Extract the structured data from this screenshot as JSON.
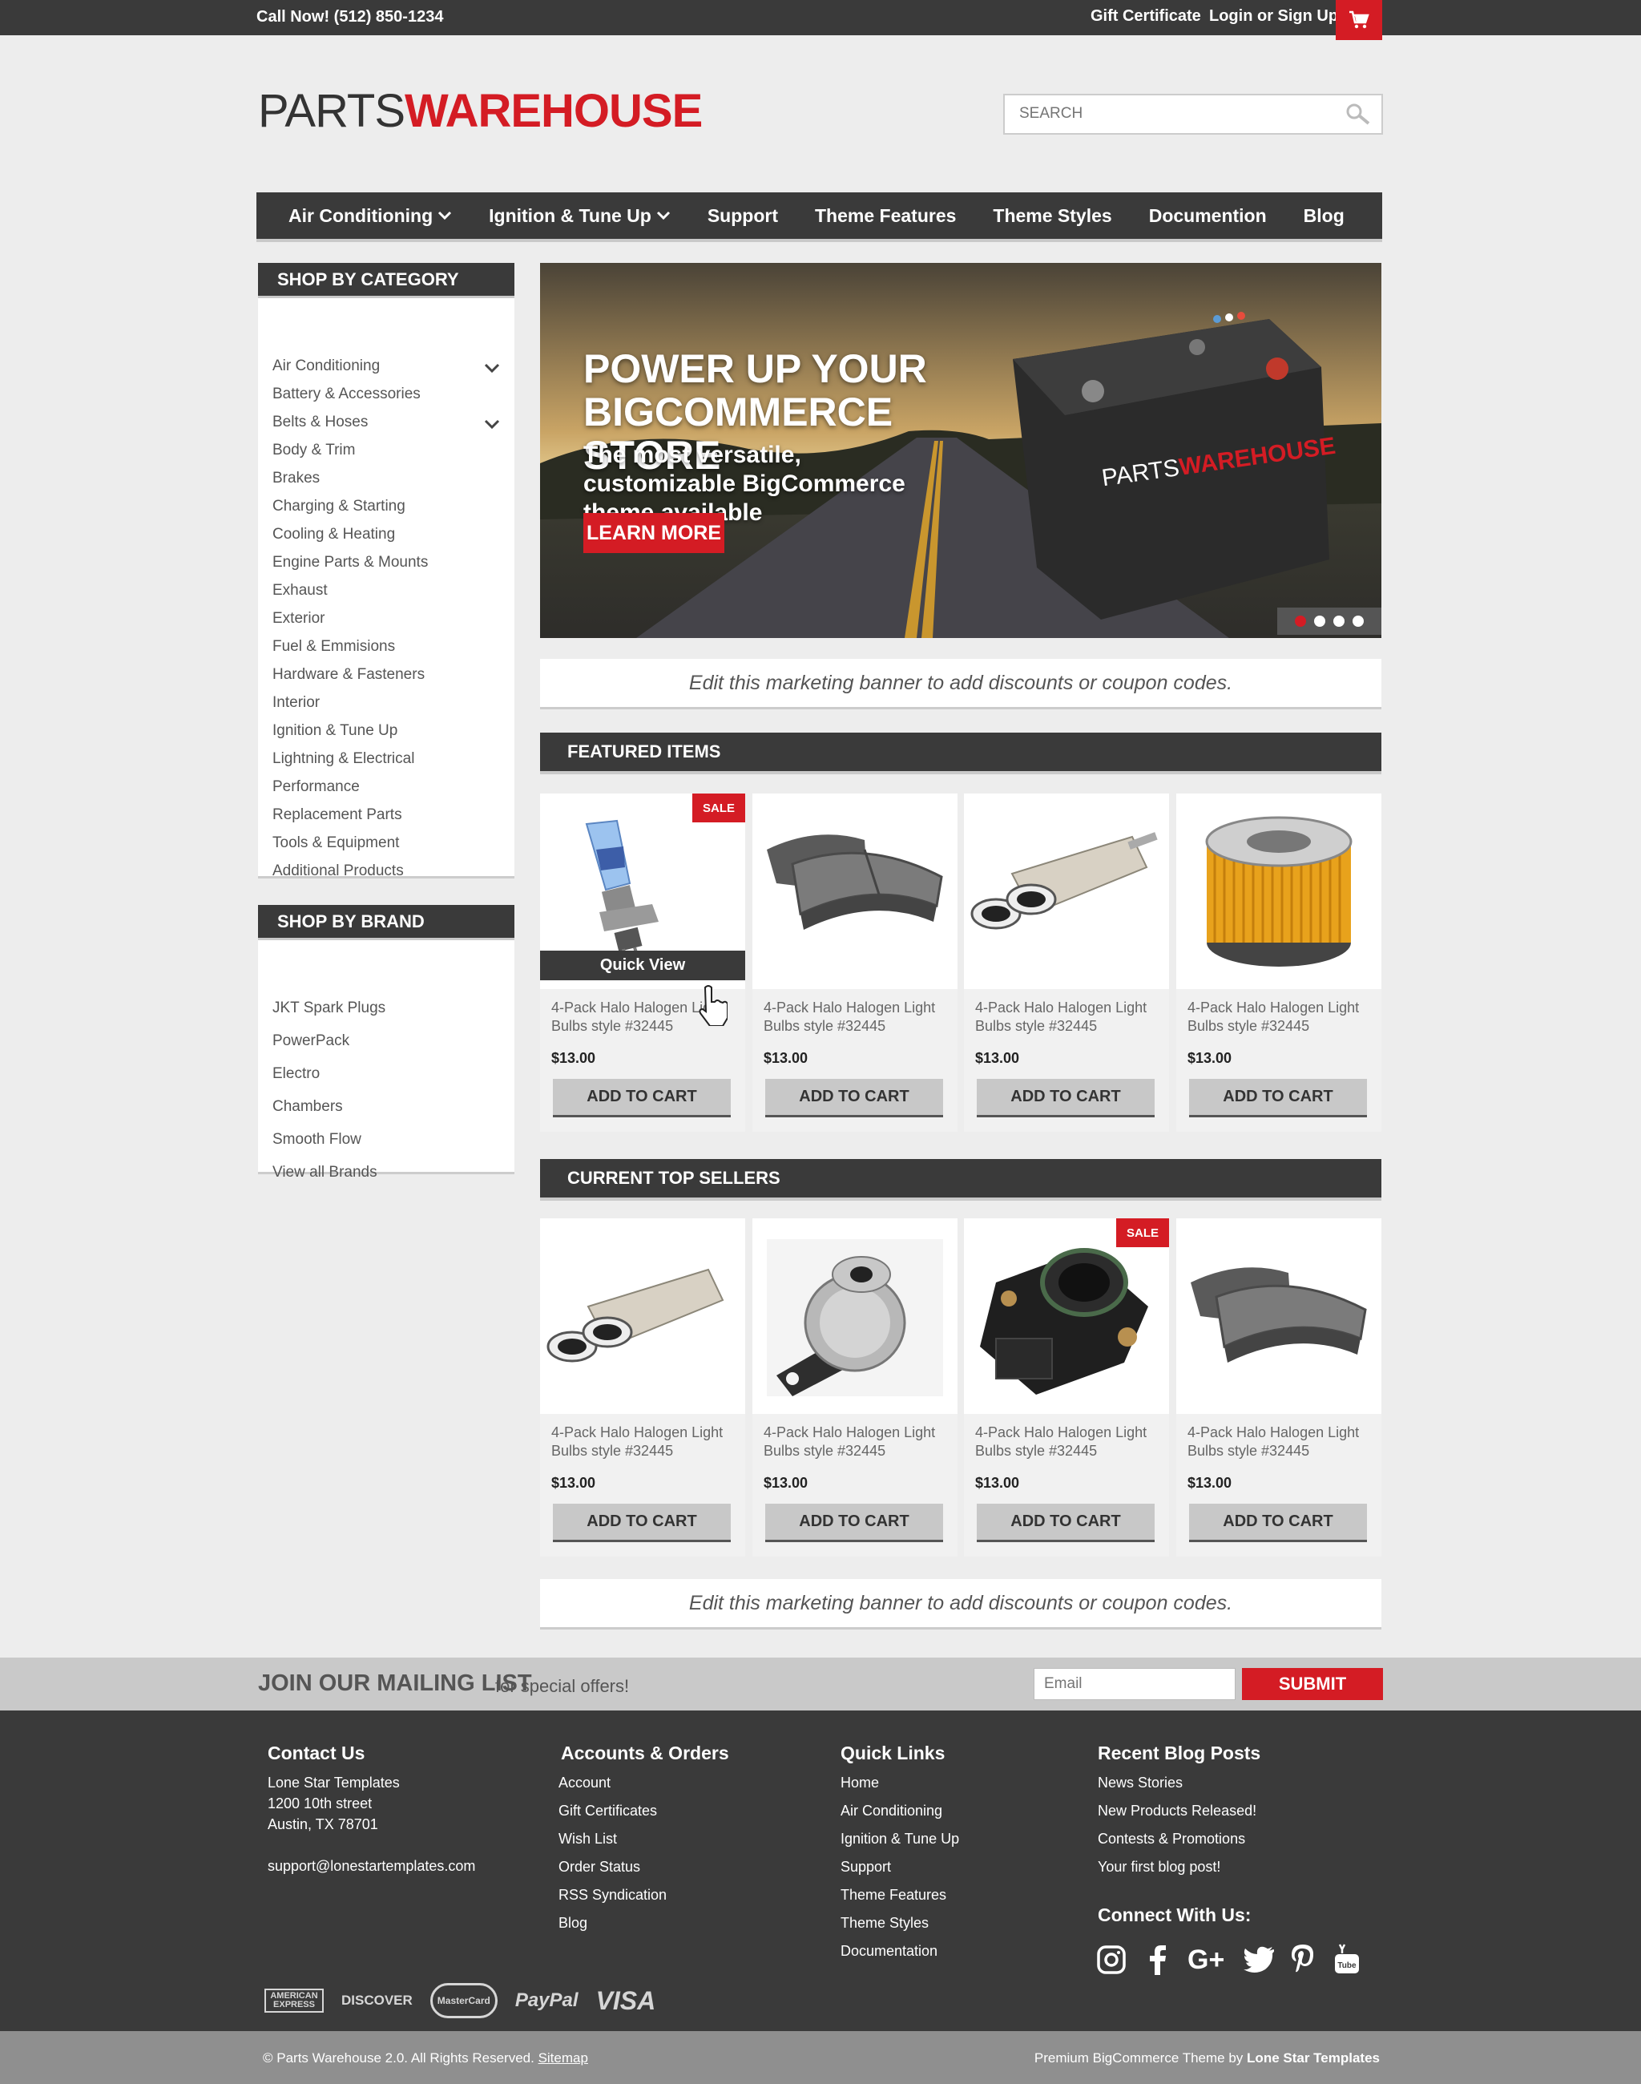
{
  "topbar": {
    "phone": "Call Now! (512) 850-1234",
    "gift_certificate": "Gift Certificate",
    "login": "Login or Sign Up",
    "cart_icon": "cart-icon"
  },
  "header": {
    "logo_part1": "PARTS",
    "logo_part2": "WAREHOUSE",
    "search_placeholder": "SEARCH",
    "search_icon": "search-icon"
  },
  "nav": {
    "items": [
      {
        "label": "Air Conditioning"
      },
      {
        "label": "Ignition & Tune Up"
      },
      {
        "label": "Support"
      },
      {
        "label": "Theme Features"
      },
      {
        "label": "Theme Styles"
      },
      {
        "label": "Documention"
      },
      {
        "label": "Blog"
      }
    ]
  },
  "categories": {
    "title": "SHOP BY CATEGORY",
    "items": [
      "Air Conditioning",
      "Battery & Accessories",
      "Belts & Hoses",
      "Body & Trim",
      "Brakes",
      "Charging & Starting",
      "Cooling & Heating",
      "Engine Parts & Mounts",
      "Exhaust",
      "Exterior",
      "Fuel & Emmisions",
      "Hardware & Fasteners",
      "Interior",
      "Ignition & Tune Up",
      "Lightning & Electrical",
      "Performance",
      "Replacement Parts",
      "Tools & Equipment",
      "Additional Products"
    ]
  },
  "brands": {
    "title": "SHOP BY BRAND",
    "items": [
      "JKT Spark Plugs",
      "PowerPack",
      "Electro",
      "Chambers",
      "Smooth Flow",
      "View all Brands"
    ]
  },
  "banner": {
    "headline": "POWER UP YOUR BIGCOMMERCE STORE",
    "subline": "The most versatile, customizable BigCommerce theme available",
    "cta": "LEARN MORE",
    "battery_brand_a": "PARTS",
    "battery_brand_b": "WAREHOUSE"
  },
  "marketing": {
    "text1": "Edit this marketing banner to add discounts or coupon codes.",
    "text2": "Edit this marketing banner to add discounts or coupon codes."
  },
  "featured": {
    "title": "FEATURED ITEMS",
    "quick_view": "Quick View",
    "products": [
      {
        "name": "4-Pack Halo Halogen Light Bulbs style #32445",
        "price": "$13.00",
        "button": "ADD TO CART",
        "badge": "SALE"
      },
      {
        "name": "4-Pack Halo Halogen Light Bulbs style #32445",
        "price": "$13.00",
        "button": "ADD TO CART"
      },
      {
        "name": "4-Pack Halo Halogen Light Bulbs style #32445",
        "price": "$13.00",
        "button": "ADD TO CART"
      },
      {
        "name": "4-Pack Halo Halogen Light Bulbs style #32445",
        "price": "$13.00",
        "button": "ADD TO CART"
      }
    ]
  },
  "top_sellers": {
    "title": "CURRENT TOP SELLERS",
    "products": [
      {
        "name": "4-Pack Halo Halogen Light Bulbs style #32445",
        "price": "$13.00",
        "button": "ADD TO CART"
      },
      {
        "name": "4-Pack Halo Halogen Light Bulbs style #32445",
        "price": "$13.00",
        "button": "ADD TO CART"
      },
      {
        "name": "4-Pack Halo Halogen Light Bulbs style #32445",
        "price": "$13.00",
        "button": "ADD TO CART",
        "badge": "SALE"
      },
      {
        "name": "4-Pack Halo Halogen Light Bulbs style #32445",
        "price": "$13.00",
        "button": "ADD TO CART"
      }
    ]
  },
  "mailing": {
    "title": "JOIN OUR MAILING LIST",
    "subtitle": "for special offers!",
    "email_placeholder": "Email",
    "submit": "SUBMIT"
  },
  "footer": {
    "contact": {
      "title": "Contact Us",
      "name": "Lone Star Templates",
      "street": "1200 10th street",
      "city": "Austin, TX 78701",
      "email": "support@lonestartemplates.com"
    },
    "accounts": {
      "title": "Accounts & Orders",
      "links": [
        "Account",
        "Gift Certificates",
        "Wish List",
        "Order Status",
        "RSS Syndication",
        "Blog"
      ]
    },
    "quick_links": {
      "title": "Quick Links",
      "links": [
        "Home",
        "Air Conditioning",
        "Ignition & Tune Up",
        "Support",
        "Theme Features",
        "Theme Styles",
        "Documentation"
      ]
    },
    "blog": {
      "title": "Recent Blog Posts",
      "links": [
        "News Stories",
        "New Products Released!",
        "Contests & Promotions",
        "Your first blog post!"
      ]
    },
    "connect_title": "Connect With Us:",
    "payments": [
      "AMERICAN EXPRESS",
      "DISCOVER",
      "MasterCard",
      "PayPal",
      "VISA"
    ],
    "social_icons": [
      "instagram-icon",
      "facebook-icon",
      "google-plus-icon",
      "twitter-icon",
      "pinterest-icon",
      "youtube-icon"
    ]
  },
  "copyright": {
    "left": "© Parts Warehouse 2.0. All Rights Reserved.",
    "sitemap": "Sitemap",
    "right_prefix": "Premium BigCommerce Theme by",
    "right_brand": "Lone Star Templates"
  },
  "colors": {
    "accent": "#d41c24",
    "dark": "#3a3a3a",
    "background": "#ededed"
  }
}
